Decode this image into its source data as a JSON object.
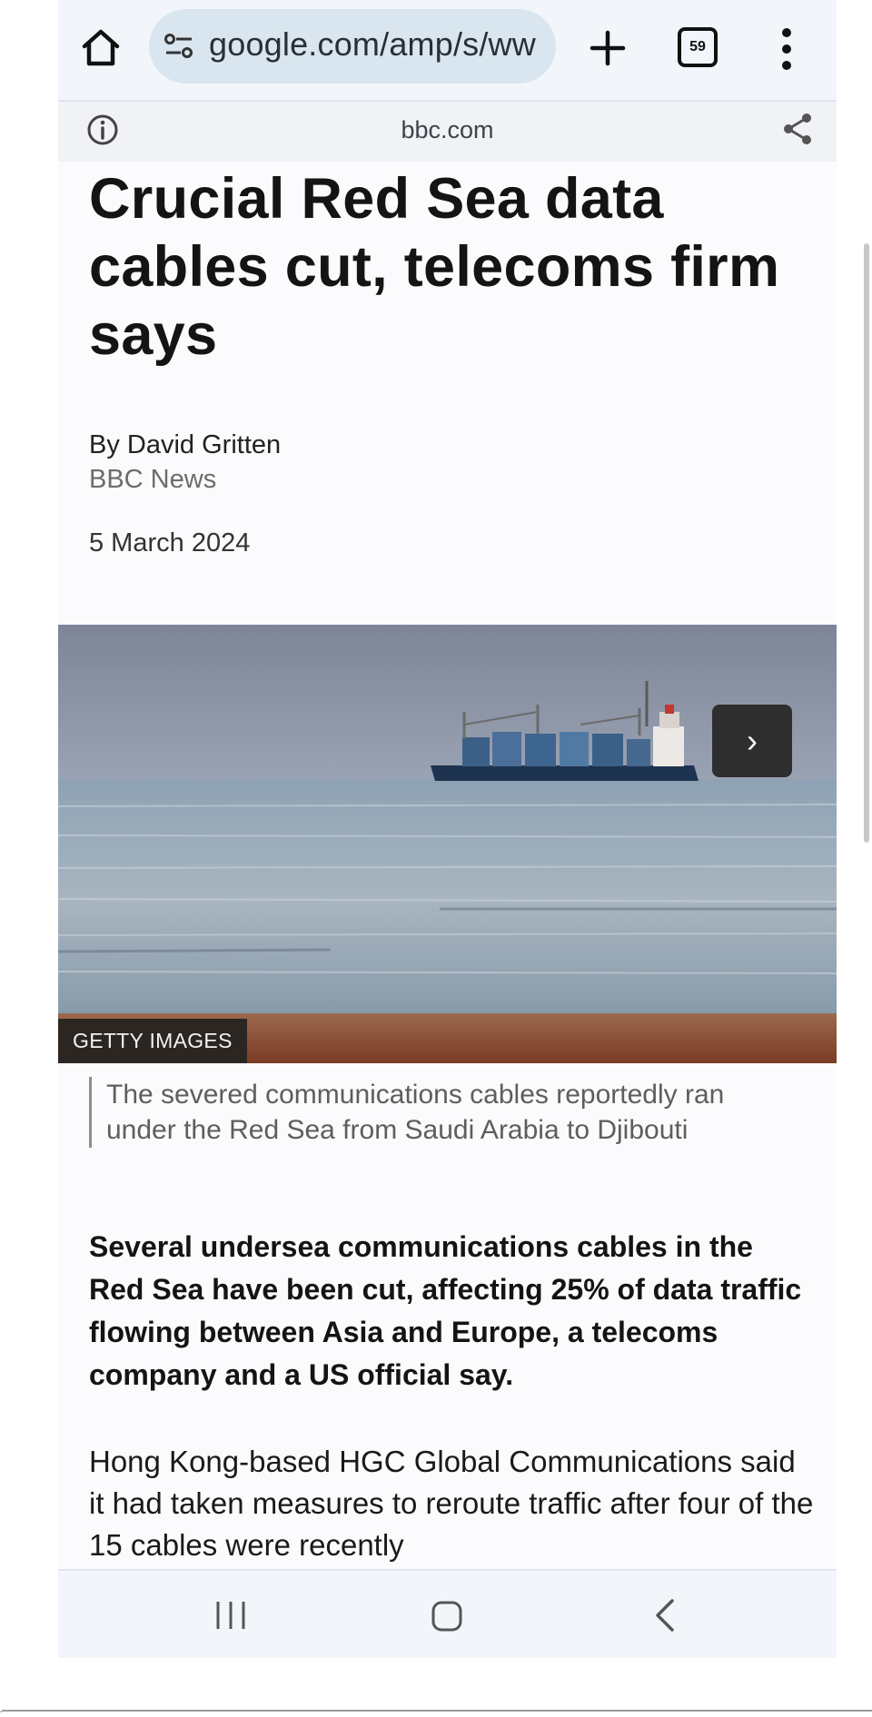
{
  "browser": {
    "url": "google.com/amp/s/ww",
    "tab_count": "59",
    "domain": "bbc.com",
    "icons": [
      "home-icon",
      "site-settings-icon",
      "new-tab-icon",
      "tab-switcher-icon",
      "more-menu-icon",
      "info-icon",
      "share-icon"
    ]
  },
  "article": {
    "title": "Crucial Red Sea data cables cut, telecoms firm says",
    "byline": "By David Gritten",
    "source": "BBC News",
    "date": "5 March 2024",
    "image_credit": "GETTY IMAGES",
    "next_glyph": "›",
    "caption": "The severed communications cables reportedly ran under the Red Sea from Saudi Arabia to Djibouti",
    "lede": "Several undersea communications cables in the Red Sea have been cut, affecting 25% of data traffic flowing between Asia and Europe, a telecoms company and a US official say.",
    "paragraph": "Hong Kong-based HGC Global Communications said it had taken measures to reroute traffic after four of the 15 cables were recently"
  },
  "system_nav": {
    "icons": [
      "recents-icon",
      "home-icon",
      "back-icon"
    ]
  }
}
